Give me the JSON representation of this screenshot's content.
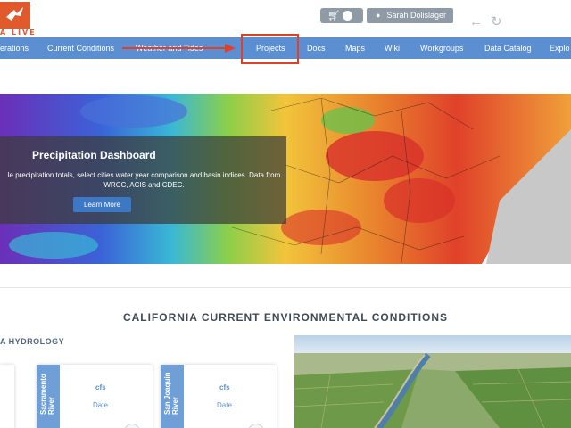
{
  "header": {
    "logo_text": "A LIVE",
    "user_name": "Sarah Dolislager",
    "icons": [
      "logo-bird-icon",
      "cart-icon",
      "user-icon",
      "back-arrow-icon",
      "refresh-icon"
    ]
  },
  "nav": {
    "items": [
      "erations",
      "Current Conditions",
      "Weather and Tides",
      "Projects",
      "Docs",
      "Maps",
      "Wiki",
      "Workgroups",
      "Data Catalog",
      "Explo"
    ]
  },
  "banner": {
    "title": "Precipitation Dashboard",
    "description": "le precipitation totals, select cities water year comparison and basin indices. Data from WRCC, ACIS and CDEC.",
    "button": "Learn More"
  },
  "section": {
    "title": "CALIFORNIA CURRENT ENVIRONMENTAL CONDITIONS",
    "hydrology_title": "A HYDROLOGY",
    "cards": [
      {
        "river": "Sacramento River",
        "unit": "cfs",
        "date": "Date"
      },
      {
        "river": "San Joaquin River",
        "unit": "cfs",
        "date": "Date"
      }
    ]
  },
  "colors": {
    "nav_bg": "#5b8fd1",
    "highlight": "#e0402a",
    "brand_orange": "#e05a2b",
    "button_blue": "#3d78c4"
  }
}
